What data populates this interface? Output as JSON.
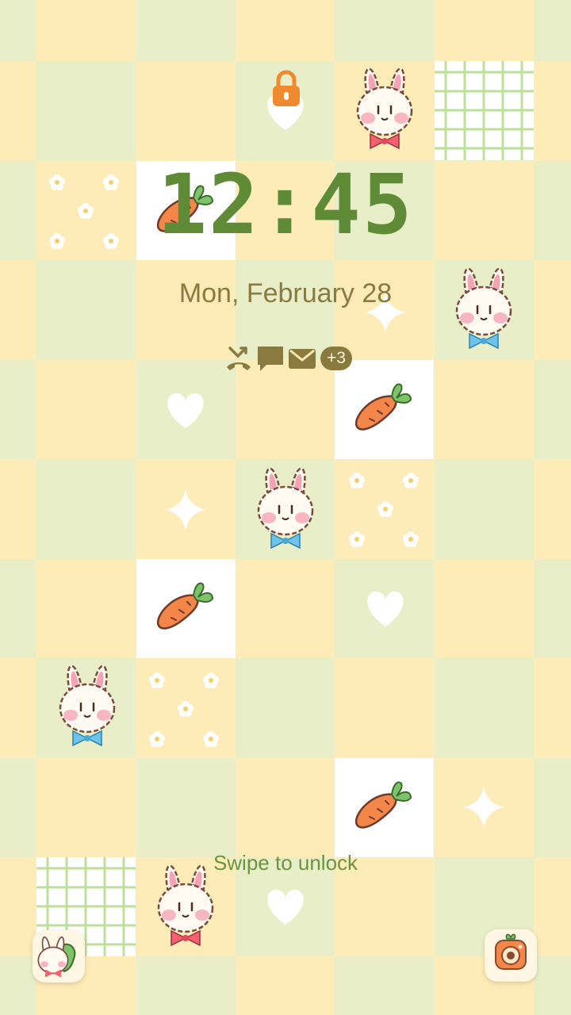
{
  "lockscreen": {
    "time": "12:45",
    "date": "Mon, February 28",
    "notifications": {
      "icons": [
        "missed-call-icon",
        "message-icon",
        "mail-icon"
      ],
      "more": "+3"
    },
    "hint": "Swipe to unlock",
    "shortcuts": {
      "left": "phone-shortcut",
      "right": "camera-shortcut"
    }
  },
  "theme": {
    "tile_yellow": "#fdebb8",
    "tile_green": "#e8efc8",
    "tile_white": "#ffffff",
    "clock_color": "#5f8a36",
    "date_color": "#8a7a3e",
    "lock_color": "#f08a30",
    "carrot_color": "#f4864a"
  }
}
